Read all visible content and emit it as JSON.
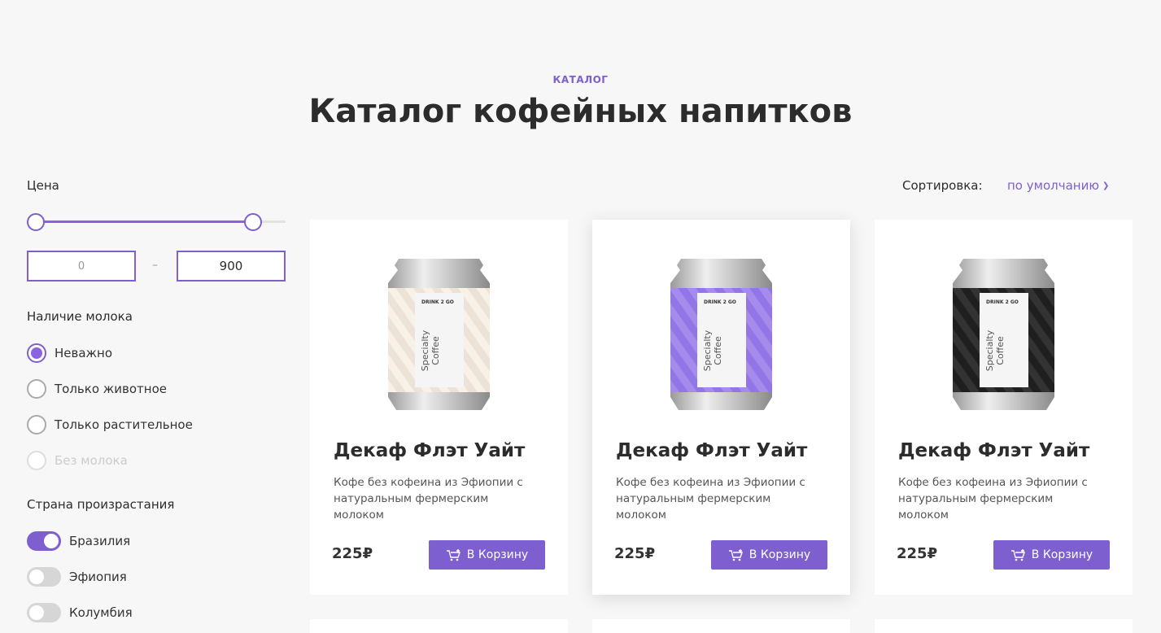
{
  "header": {
    "eyebrow": "КАТАЛОГ",
    "title": "Каталог кофейных напитков"
  },
  "filters": {
    "price": {
      "label": "Цена",
      "min_value": "",
      "min_placeholder": "0",
      "max_value": "900",
      "range_min_fraction": 0,
      "range_max_fraction": 0.87
    },
    "milk": {
      "label": "Наличие молока",
      "options": [
        {
          "label": "Неважно",
          "checked": true,
          "disabled": false
        },
        {
          "label": "Только животное",
          "checked": false,
          "disabled": false
        },
        {
          "label": "Только растительное",
          "checked": false,
          "disabled": false
        },
        {
          "label": "Без молока",
          "checked": false,
          "disabled": true
        }
      ]
    },
    "country": {
      "label": "Страна произрастания",
      "options": [
        {
          "label": "Бразилия",
          "on": true
        },
        {
          "label": "Эфиопия",
          "on": false
        },
        {
          "label": "Колумбия",
          "on": false
        }
      ]
    }
  },
  "sort": {
    "label": "Сортировка:",
    "value": "по умолчанию"
  },
  "products": [
    {
      "title": "Декаф Флэт Уайт",
      "description": "Кофе без кофеина из Эфиопии с натуральным фермерским молоком",
      "price": "225₽",
      "button_label": "В Корзину",
      "can_color": "#ece3d6",
      "can_stripe": "#f7f1e8",
      "can_brand": "DRINK 2 GO",
      "can_text_1": "Specialty",
      "can_text_2": "Coffee"
    },
    {
      "title": "Декаф Флэт Уайт",
      "description": "Кофе без кофеина из Эфиопии с натуральным фермерским молоком",
      "price": "225₽",
      "button_label": "В Корзину",
      "can_color": "#9275e6",
      "can_stripe": "#a58cec",
      "can_brand": "DRINK 2 GO",
      "can_text_1": "Specialty",
      "can_text_2": "Coffee"
    },
    {
      "title": "Декаф Флэт Уайт",
      "description": "Кофе без кофеина из Эфиопии с натуральным фермерским молоком",
      "price": "225₽",
      "button_label": "В Корзину",
      "can_color": "#1f1f1f",
      "can_stripe": "#333333",
      "can_brand": "DRINK 2 GO",
      "can_text_1": "Specialty",
      "can_text_2": "Coffee"
    }
  ],
  "colors": {
    "accent": "#7d5fcf",
    "background": "#f7f7f7"
  }
}
